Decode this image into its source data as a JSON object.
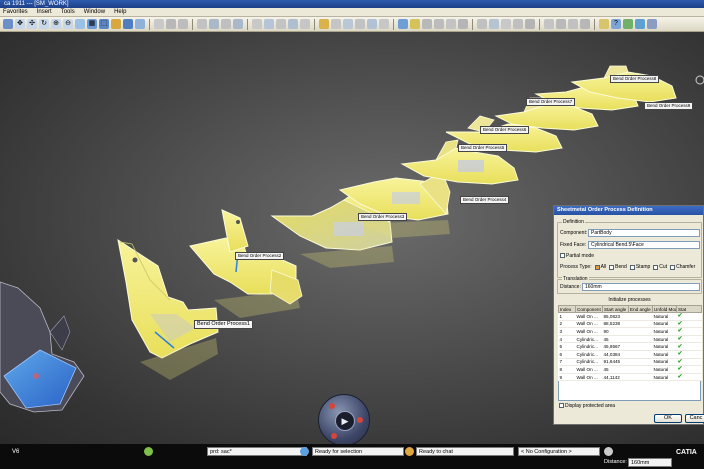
{
  "window": {
    "title": "ca 1911 --- [SM_WORK]"
  },
  "menu": [
    "Favorites",
    "Insert",
    "Tools",
    "Window",
    "Help"
  ],
  "viewport": {
    "leaders": [
      "Bend Order Process1",
      "Bend Order Process2",
      "Bend Order Process3",
      "Bend Order Process4",
      "Bend Order Process5",
      "Bend Order Process6",
      "Bend Order Process7",
      "Bend Order Process8",
      "Bend Order Process9"
    ]
  },
  "dialog": {
    "title": "Sheetmetal Order Process Definition",
    "definition_group": "Definition",
    "component_label": "Component:",
    "component_value": "PartBody",
    "fixed_face_label": "Fixed Face:",
    "fixed_face_value": "Cylindrical Bend.5\\Face",
    "partial_mode": "Partial mode",
    "process_type_label": "Process Type:",
    "process_types": [
      "All",
      "Bend",
      "Stamp",
      "Cut",
      "Chamfer"
    ],
    "translation_group": "Translation",
    "distance_label": "Distance:",
    "distance_value": "160mm",
    "init_label": "Initialize processes",
    "columns": [
      "Index",
      "Component",
      "Start angle",
      "End angle",
      "Unfold Mode",
      "Stat"
    ],
    "rows": [
      {
        "index": "1",
        "component": "Wall On ...",
        "start": "85,0823",
        "end": "",
        "mode": "Natural"
      },
      {
        "index": "2",
        "component": "Wall On ...",
        "start": "88,5238",
        "end": "",
        "mode": "Natural"
      },
      {
        "index": "3",
        "component": "Wall On ...",
        "start": "90",
        "end": "",
        "mode": "Natural"
      },
      {
        "index": "4",
        "component": "Cylindric...",
        "start": "45",
        "end": "",
        "mode": "Natural"
      },
      {
        "index": "5",
        "component": "Cylindric...",
        "start": "45,9567",
        "end": "",
        "mode": "Natural"
      },
      {
        "index": "6",
        "component": "Cylindric...",
        "start": "44,0384",
        "end": "",
        "mode": "Natural"
      },
      {
        "index": "7",
        "component": "Cylindric...",
        "start": "91,6445",
        "end": "",
        "mode": "Natural"
      },
      {
        "index": "8",
        "component": "Wall On ...",
        "start": "45",
        "end": "",
        "mode": "Natural"
      },
      {
        "index": "9",
        "component": "Wall On ...",
        "start": "44,1142",
        "end": "",
        "mode": "Natural"
      }
    ],
    "display_protected": "Display protected area",
    "ok_label": "OK",
    "cancel_label": "Canc"
  },
  "status": {
    "version": "V6",
    "command_field": "prd: sac*",
    "selection_status": "Ready for selection",
    "chat_status": "Ready to chat",
    "config": "< No Configuration >",
    "distance_label": "Distance:",
    "distance_value": "160mm",
    "brand": "CATIA"
  },
  "colors": {
    "part_fill": "#f3ef7a",
    "part_edge": "#fbfbd8",
    "selection": "#2f7fe0",
    "titlebar": "#2e5bb0",
    "check": "#2fa52b"
  }
}
